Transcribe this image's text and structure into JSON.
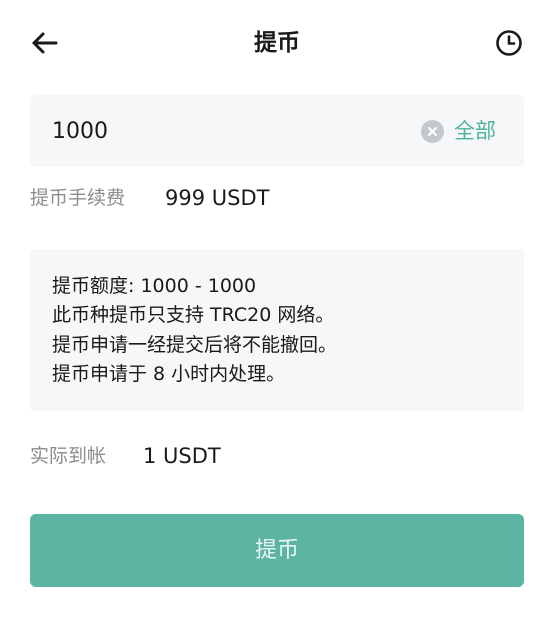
{
  "header": {
    "title": "提币",
    "back_icon": "arrow-left-icon",
    "history_icon": "clock-icon"
  },
  "amount": {
    "value": "1000",
    "clear_icon": "close-circle-icon",
    "all_label": "全部"
  },
  "fee": {
    "label": "提币手续费",
    "value": "999 USDT"
  },
  "notice": {
    "lines": [
      "提币额度: 1000 - 1000",
      "此币种提币只支持 TRC20 网络。",
      "提币申请一经提交后将不能撤回。",
      "提币申请于 8 小时内处理。"
    ]
  },
  "received": {
    "label": "实际到帐",
    "value": "1 USDT"
  },
  "submit": {
    "label": "提币"
  },
  "colors": {
    "accent": "#5cb5a2",
    "accent_text": "#4fb29e",
    "panel_bg": "#f6f7f9",
    "label_gray": "#8a8d91"
  }
}
